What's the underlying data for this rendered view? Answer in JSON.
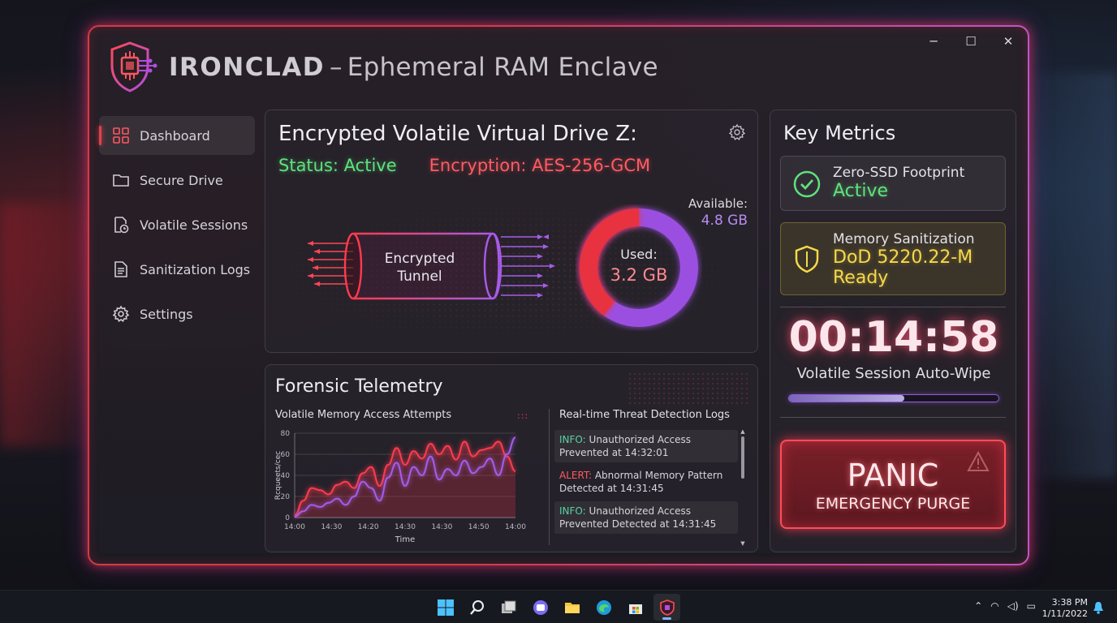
{
  "app": {
    "brand": "IRONCLAD",
    "separator": "–",
    "subtitle": "Ephemeral RAM Enclave"
  },
  "window_controls": {
    "minimize": "─",
    "maximize": "☐",
    "close": "✕"
  },
  "sidebar": {
    "items": [
      {
        "label": "Dashboard",
        "icon": "dashboard-grid-icon",
        "active": true
      },
      {
        "label": "Secure Drive",
        "icon": "folder-icon",
        "active": false
      },
      {
        "label": "Volatile Sessions",
        "icon": "document-clock-icon",
        "active": false
      },
      {
        "label": "Sanitization Logs",
        "icon": "document-lines-icon",
        "active": false
      },
      {
        "label": "Settings",
        "icon": "gear-icon",
        "active": false
      }
    ]
  },
  "drive": {
    "title": "Encrypted Volatile Virtual Drive Z:",
    "status": "Status: Active",
    "encryption": "Encryption: AES-256-GCM",
    "tunnel_label_1": "Encrypted",
    "tunnel_label_2": "Tunnel",
    "used_label": "Used:",
    "used_value": "3.2 GB",
    "used_gb": 3.2,
    "available_label": "Available:",
    "available_value": "4.8 GB",
    "available_gb": 4.8,
    "colors": {
      "used": "#e8323f",
      "available": "#9b4fe0"
    }
  },
  "telemetry": {
    "title": "Forensic Telemetry",
    "chart_title": "Volatile Memory Access Attempts",
    "logs_title": "Real-time Threat Detection Logs",
    "logs": [
      {
        "level": "INFO:",
        "message": "Unauthorized Access Prevented at 14:32:01"
      },
      {
        "level": "ALERT:",
        "message": "Abnormal Memory Pattern Detected at 14:31:45"
      },
      {
        "level": "INFO:",
        "message": "Unauthorized Access Prevented Detected at 14:31:45"
      }
    ]
  },
  "chart_data": {
    "type": "line",
    "title": "Volatile Memory Access Attempts",
    "xlabel": "Time",
    "ylabel": "Rcqueets/ceс",
    "x": [
      "14:00",
      "14:30",
      "14:20",
      "14:30",
      "14:30",
      "14:50",
      "14:00"
    ],
    "ylim": [
      0,
      80
    ],
    "yticks": [
      0,
      20,
      40,
      60,
      80
    ],
    "series": [
      {
        "color": "#ff3b4e",
        "values": [
          2,
          16,
          28,
          26,
          22,
          31,
          34,
          28,
          42,
          48,
          30,
          50,
          66,
          50,
          63,
          56,
          70,
          60,
          68,
          55,
          72,
          58,
          64,
          66,
          72,
          58,
          44
        ]
      },
      {
        "color": "#a65ce8",
        "values": [
          1,
          6,
          12,
          10,
          14,
          18,
          12,
          20,
          34,
          28,
          16,
          38,
          52,
          30,
          48,
          40,
          58,
          36,
          46,
          40,
          54,
          42,
          48,
          56,
          40,
          60,
          76
        ]
      }
    ]
  },
  "metrics": {
    "title": "Key Metrics",
    "ssd_label": "Zero-SSD Footprint",
    "ssd_value": "Active",
    "mem_label": "Memory Sanitization",
    "mem_value_1": "DoD 5220.22-M",
    "mem_value_2": "Ready",
    "timer": "00:14:58",
    "timer_label": "Volatile Session Auto-Wipe",
    "wipe_progress": 0.55,
    "panic_main": "PANIC",
    "panic_sub": "EMERGENCY PURGE"
  },
  "taskbar": {
    "apps": [
      "windows-start-icon",
      "search-icon",
      "task-view-icon",
      "chat-icon",
      "file-explorer-icon",
      "edge-browser-icon",
      "store-icon",
      "ironclad-app-icon"
    ],
    "time": "3:38 PM",
    "date": "1/11/2022"
  }
}
